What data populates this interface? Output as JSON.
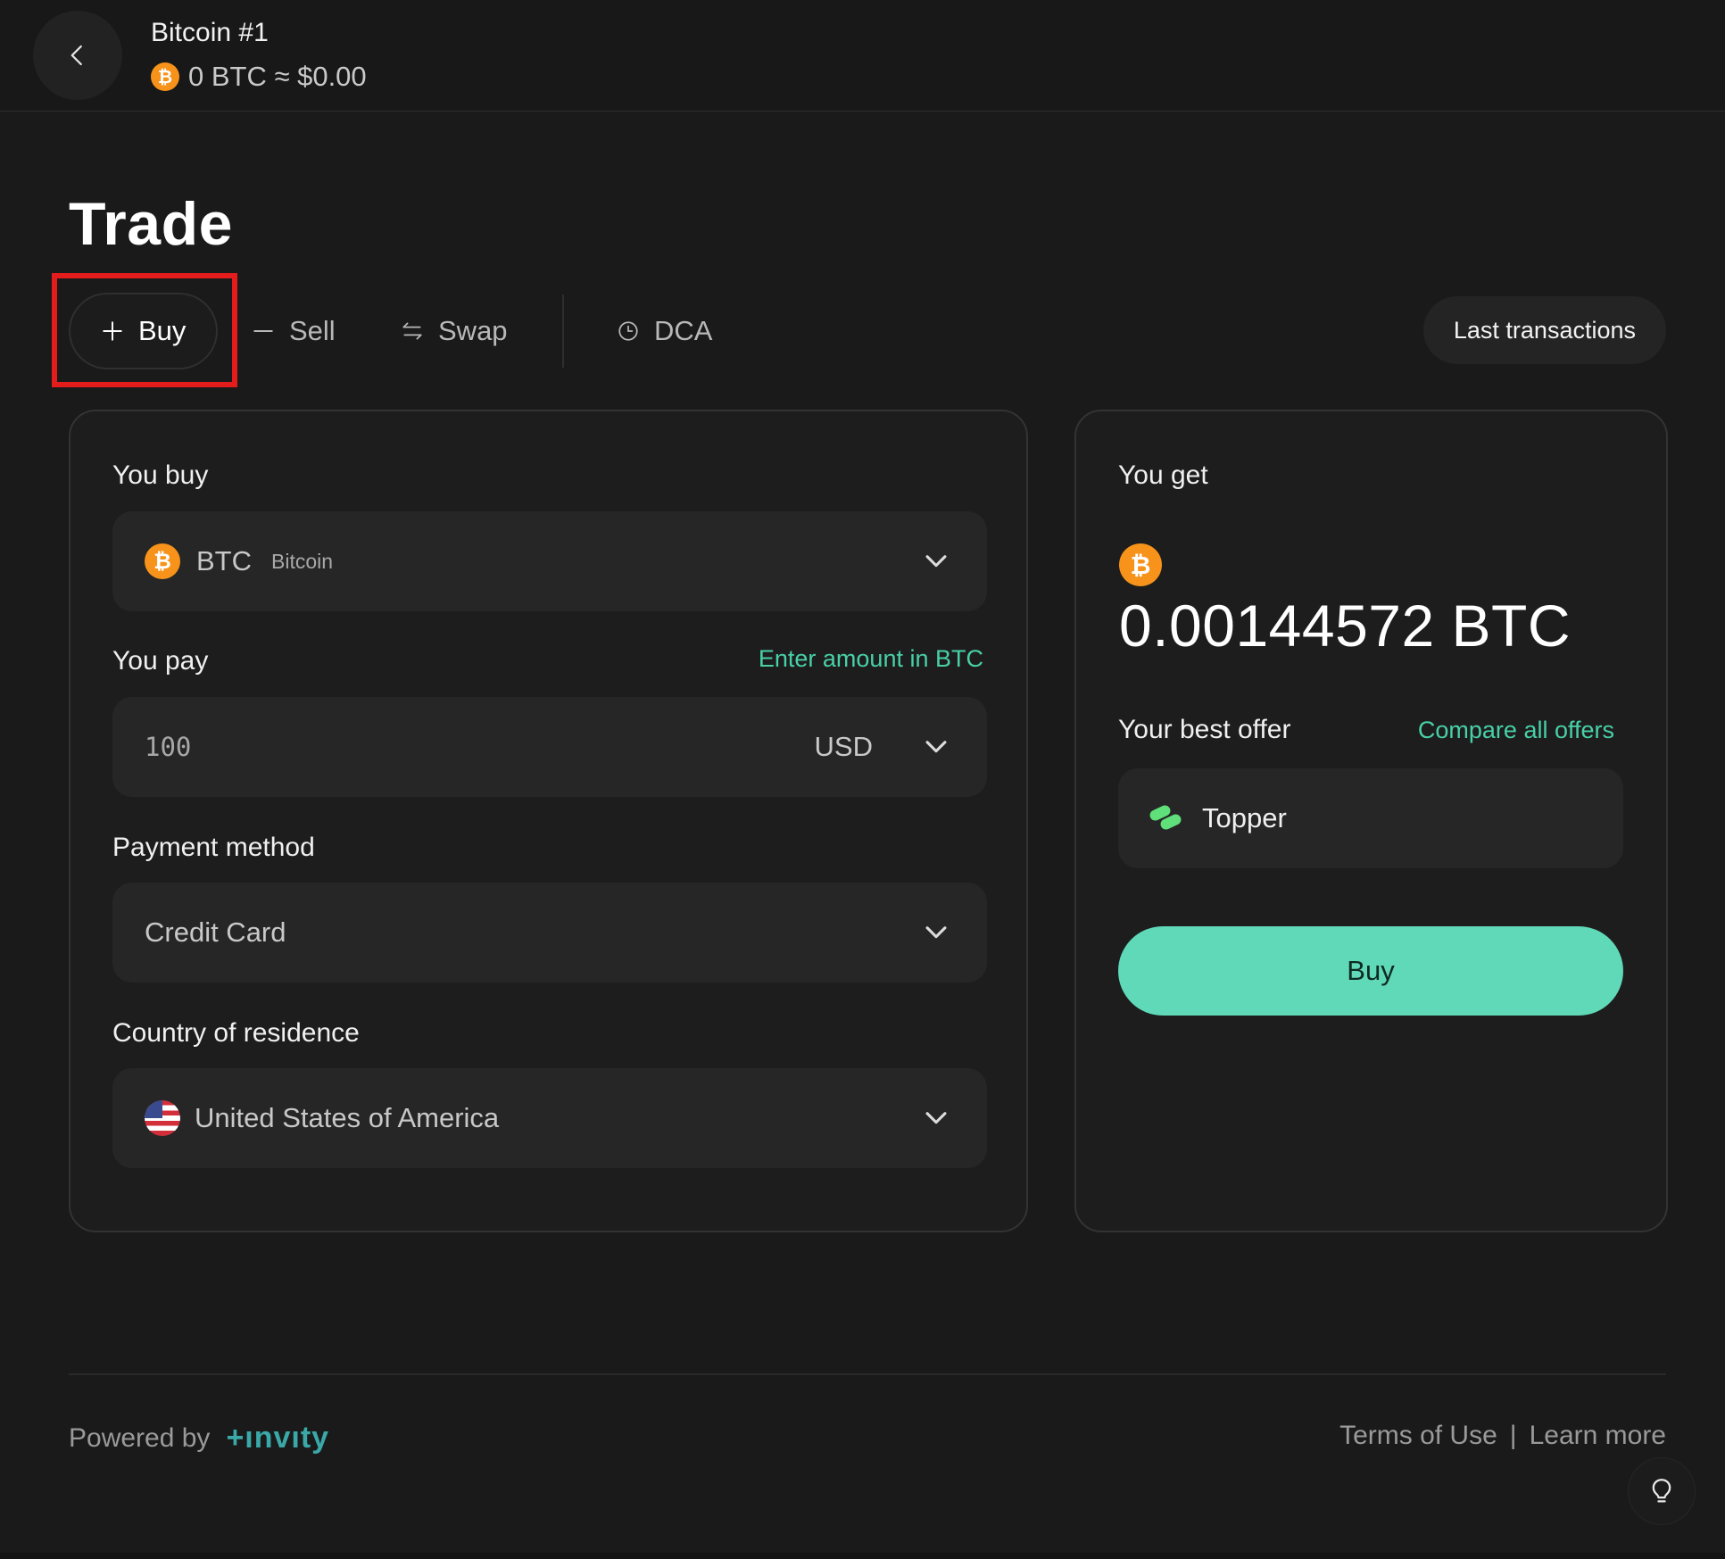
{
  "header": {
    "account_name": "Bitcoin #1",
    "balance": "0 BTC ≈ $0.00"
  },
  "page_title": "Trade",
  "tabs": [
    {
      "label": "Buy",
      "icon": "plus-icon",
      "active": true
    },
    {
      "label": "Sell",
      "icon": "minus-icon",
      "active": false
    },
    {
      "label": "Swap",
      "icon": "swap-icon",
      "active": false
    },
    {
      "label": "DCA",
      "icon": "clock-icon",
      "active": false
    }
  ],
  "last_transactions_label": "Last transactions",
  "buy_form": {
    "you_buy_label": "You buy",
    "coin_symbol": "BTC",
    "coin_name": "Bitcoin",
    "you_pay_label": "You pay",
    "enter_amount_link": "Enter amount in BTC",
    "pay_amount": "100",
    "pay_currency": "USD",
    "payment_method_label": "Payment method",
    "payment_method": "Credit Card",
    "country_label": "Country of residence",
    "country": "United States of America"
  },
  "offer": {
    "you_get_label": "You get",
    "amount": "0.00144572 BTC",
    "best_offer_label": "Your best offer",
    "compare_link": "Compare all offers",
    "provider": "Topper",
    "buy_button": "Buy"
  },
  "footer": {
    "powered_by": "Powered by",
    "brand": "+ınvıty",
    "terms": "Terms of Use",
    "separator": "|",
    "learn_more": "Learn more"
  },
  "colors": {
    "accent": "#5fd9b8",
    "link": "#48d0a6",
    "bitcoin": "#f7931a",
    "highlight": "#e51c1c"
  }
}
